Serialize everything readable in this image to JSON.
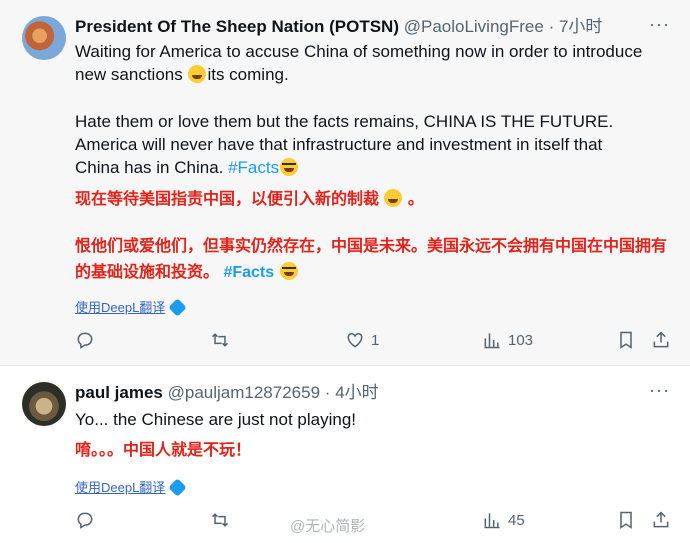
{
  "tweets": [
    {
      "name": "President Of The Sheep Nation (POTSN)",
      "handle": "@PaoloLivingFree",
      "dot": "·",
      "time": "7小时",
      "text_line1a": "Waiting for America to accuse China of something now in order to introduce",
      "text_line1b": "new sanctions ",
      "text_line1c": "its coming.",
      "text_p2a": "Hate them or love them but the facts remains, CHINA IS THE FUTURE.",
      "text_p2b": "America will never have that  infrastructure and investment in itself that",
      "text_p2c": "China has in China. ",
      "hashtag": "#Facts",
      "cn_line1": "现在等待美国指责中国，以便引入新的制裁 ",
      "cn_line1_end": " 。",
      "cn_p2": "恨他们或爱他们，但事实仍然存在，中国是未来。美国永远不会拥有中国在中国拥有的基础设施和投资。 ",
      "cn_hashtag": "#Facts",
      "translate": "使用DeepL翻译",
      "replies": "",
      "retweets": "",
      "likes": "1",
      "views": "103"
    },
    {
      "name": "paul james",
      "handle": "@pauljam12872659",
      "dot": "·",
      "time": "4小时",
      "text": "Yo... the Chinese are just not playing!",
      "cn": "唷。。。中国人就是不玩！",
      "translate": "使用DeepL翻译",
      "replies": "",
      "retweets": "",
      "likes": "",
      "views": "45"
    }
  ],
  "more_label": "···",
  "watermark": "@无心简影",
  "icons": {
    "reply": "reply-icon",
    "retweet": "retweet-icon",
    "like": "heart-icon",
    "views": "views-icon",
    "bookmark": "bookmark-icon",
    "share": "share-icon"
  }
}
